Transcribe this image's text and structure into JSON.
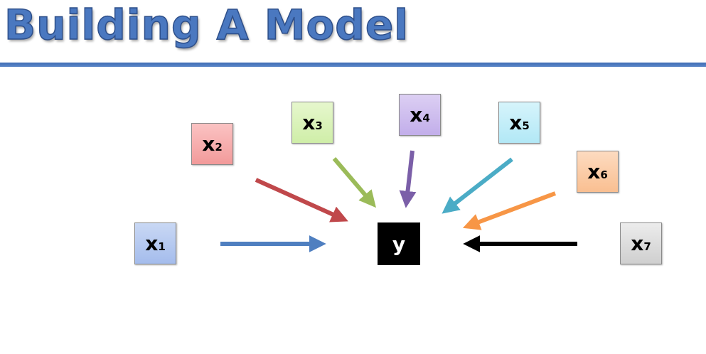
{
  "title": "Building A Model",
  "target": "y",
  "inputs": [
    {
      "var": "x",
      "sub": "1",
      "color": "#4f7fc0"
    },
    {
      "var": "x",
      "sub": "2",
      "color": "#c0484b"
    },
    {
      "var": "x",
      "sub": "3",
      "color": "#9bbb59"
    },
    {
      "var": "x",
      "sub": "4",
      "color": "#7b5fa8"
    },
    {
      "var": "x",
      "sub": "5",
      "color": "#4bacc6"
    },
    {
      "var": "x",
      "sub": "6",
      "color": "#f79646"
    },
    {
      "var": "x",
      "sub": "7",
      "color": "#000000"
    }
  ]
}
